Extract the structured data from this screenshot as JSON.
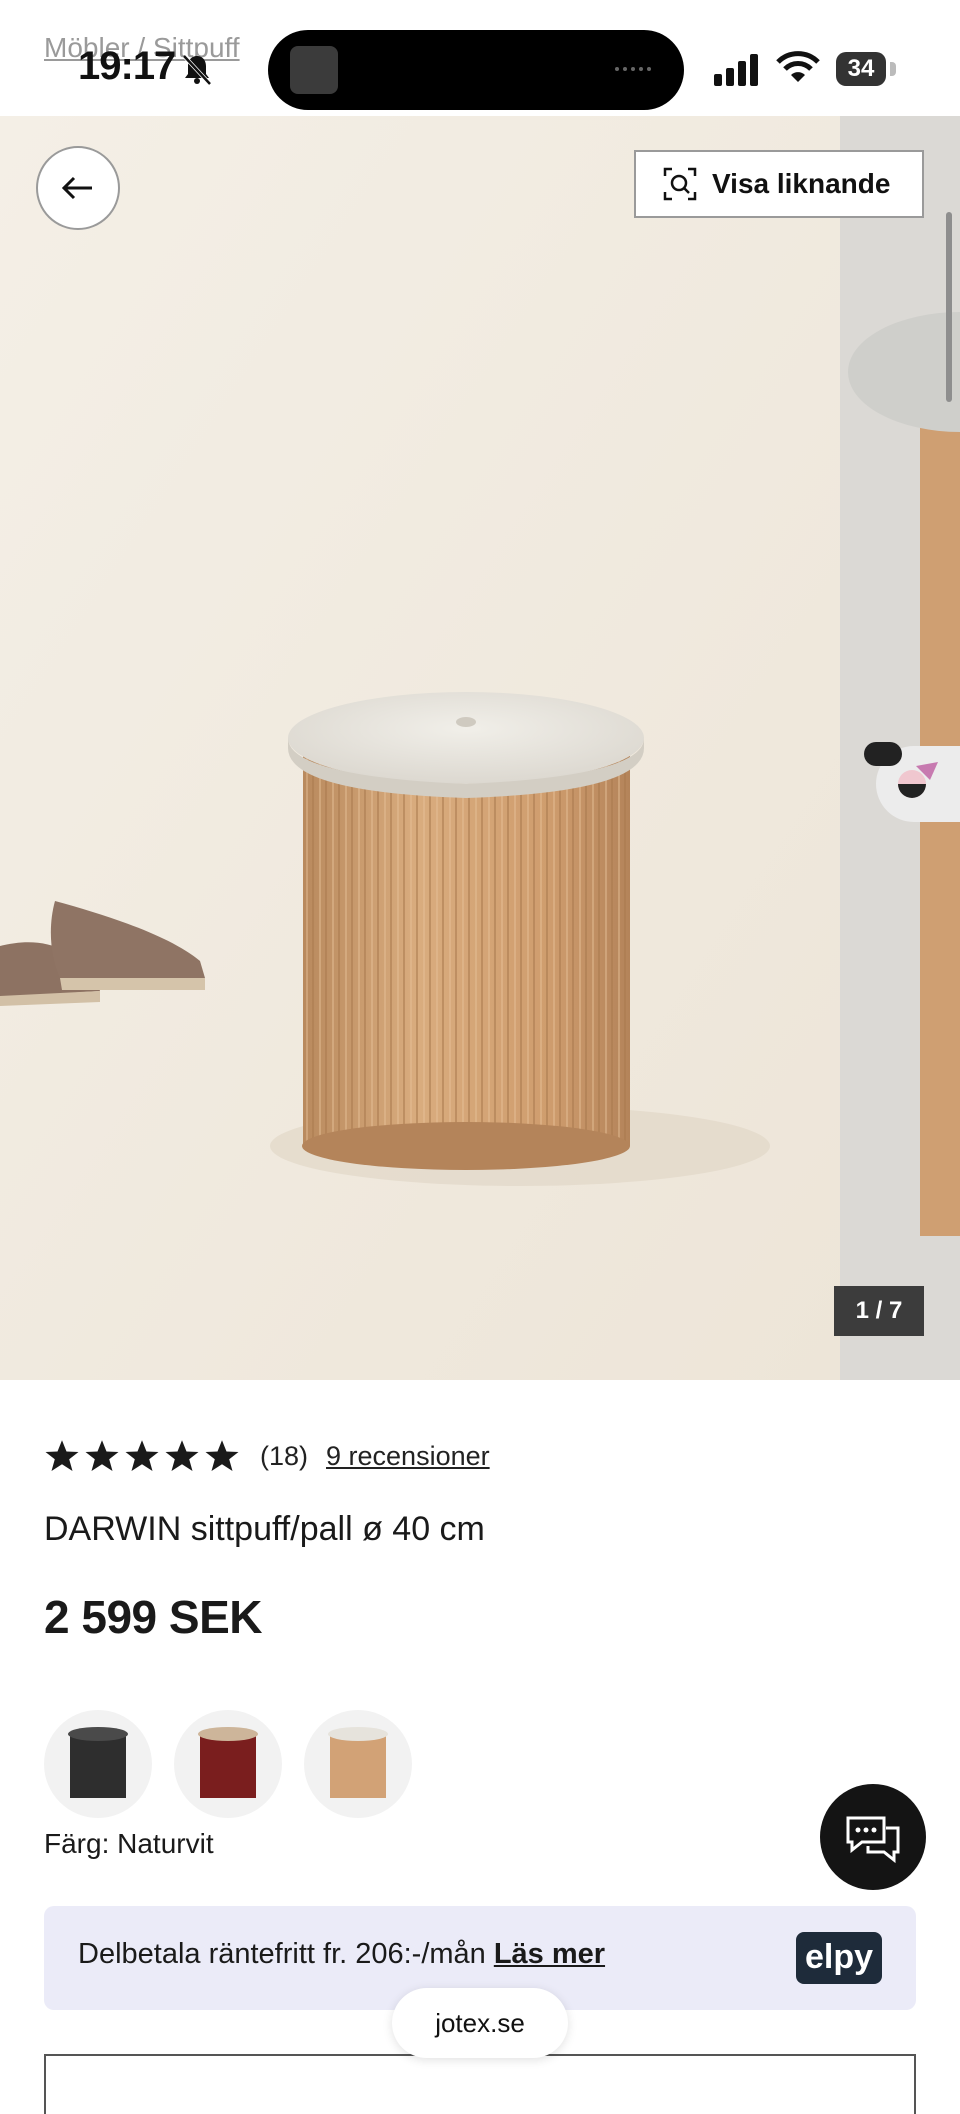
{
  "status_bar": {
    "time": "19:17",
    "battery": "34",
    "breadcrumb": "Möbler  /  Sittpuff"
  },
  "gallery": {
    "back_icon": "arrow-left-icon",
    "similar_label": "Visa liknande",
    "counter": "1 / 7"
  },
  "product": {
    "rating": 5,
    "rating_count": "(18)",
    "reviews_link": "9 recensioner",
    "title": "DARWIN sittpuff/pall ø 40 cm",
    "price": "2 599 SEK",
    "color_label": "Färg: Naturvit",
    "swatches": [
      {
        "name": "Svart",
        "color": "#3a3a3a"
      },
      {
        "name": "Röd",
        "color": "#7a1e1e"
      },
      {
        "name": "Naturvit",
        "color": "#c9996c"
      }
    ]
  },
  "installment": {
    "text": "Delbetala räntefritt fr. 206:-/mån",
    "link": "Läs mer",
    "brand": "elpy"
  },
  "browser": {
    "url": "jotex.se"
  },
  "colors": {
    "accent": "#141414",
    "installment_bg": "#ebebf8",
    "elpy": "#1e2b3a"
  }
}
